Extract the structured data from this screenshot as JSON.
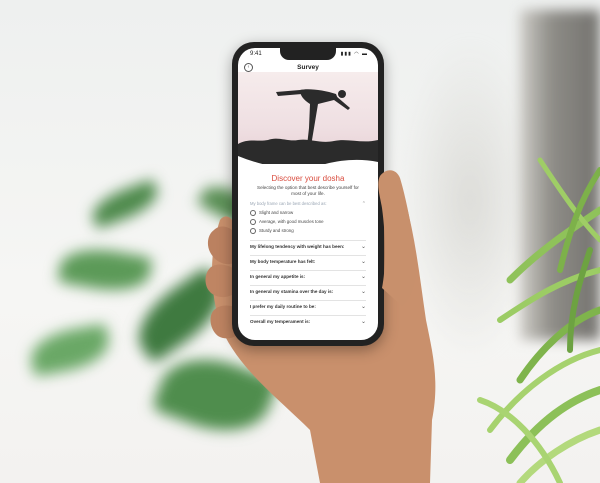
{
  "app": {
    "status_time": "9:41",
    "status_icons": "▮▮▮ ◠ ▬",
    "nav_title": "Survey",
    "back_icon": "back-icon"
  },
  "survey": {
    "headline": "Discover your dosha",
    "subhead": "Selecting the option that best describe yourself for most of your life.",
    "first_question": "My body frame can be best described as:",
    "options": [
      "Slight and narrow",
      "Average, with good muscles tone",
      "Sturdy and strong"
    ],
    "questions": [
      "My lifelong tendency with weight has been:",
      "My body temperature has felt:",
      "In general my appetite is:",
      "In general my stamina over the day is:",
      "I prefer my daily routine to be:",
      "Overall my temperament is:"
    ]
  },
  "colors": {
    "accent": "#d94b3d",
    "hero_bg": "#efdfe2",
    "silhouette": "#2b2b2b"
  }
}
